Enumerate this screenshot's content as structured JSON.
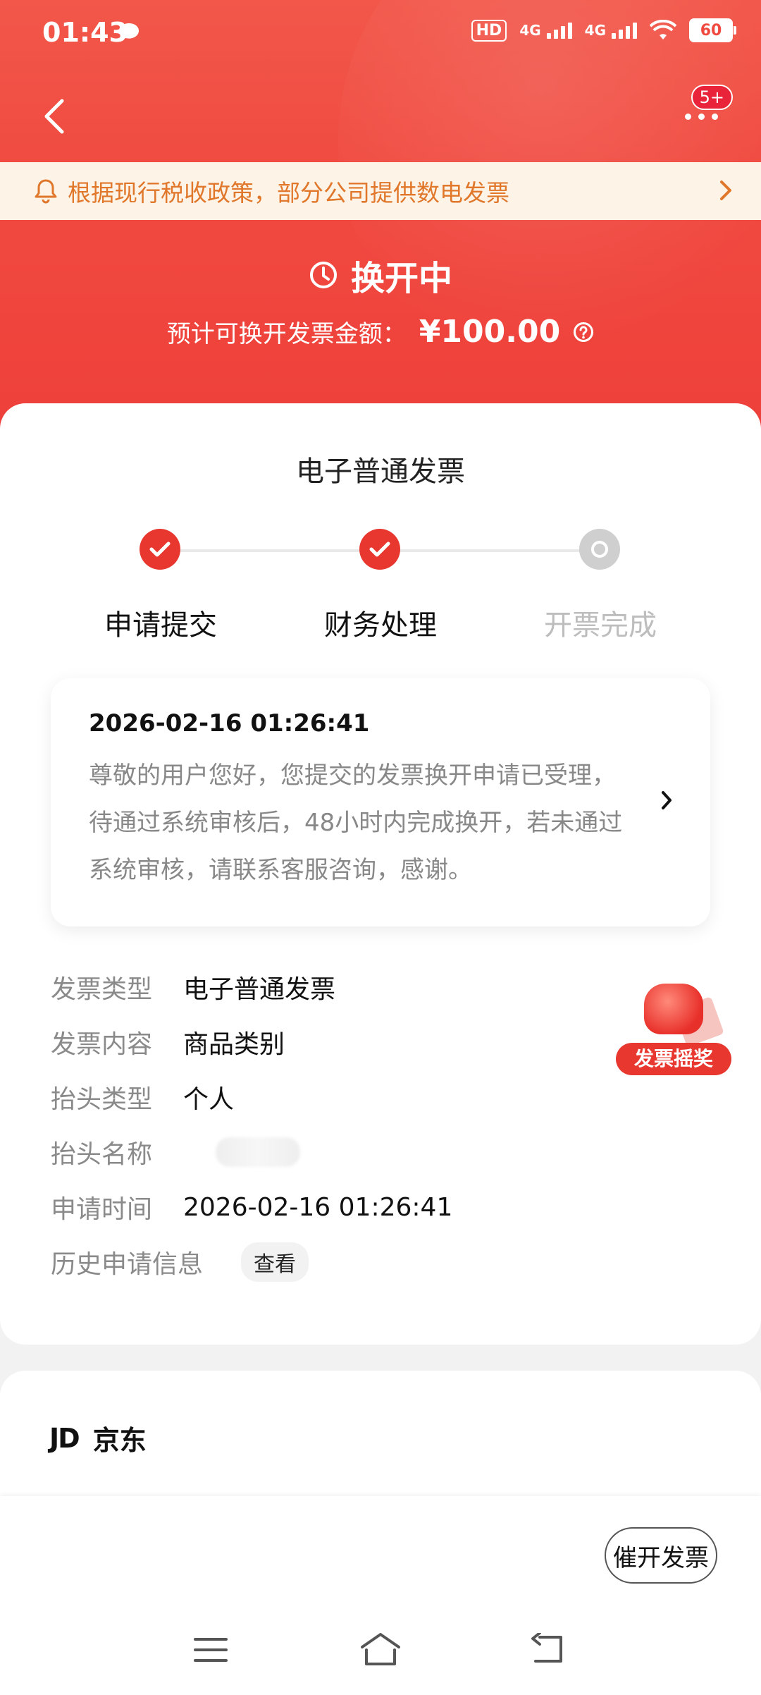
{
  "status_bar": {
    "time": "01:43",
    "hd_label": "HD",
    "net1": "4G",
    "net2": "4G",
    "battery": "60"
  },
  "nav": {
    "more_badge": "5+"
  },
  "notice": {
    "text": "根据现行税收政策，部分公司提供数电发票"
  },
  "hero": {
    "status": "换开中",
    "amount_label": "预计可换开发票金额：",
    "amount": "¥100.00"
  },
  "invoice": {
    "title": "电子普通发票",
    "steps": [
      {
        "label": "申请提交",
        "state": "done"
      },
      {
        "label": "财务处理",
        "state": "done"
      },
      {
        "label": "开票完成",
        "state": "pending"
      }
    ],
    "message": {
      "time": "2026-02-16 01:26:41",
      "text": "尊敬的用户您好，您提交的发票换开申请已受理，待通过系统审核后，48小时内完成换开，若未通过系统审核，请联系客服咨询，感谢。"
    },
    "details": [
      {
        "key": "发票类型",
        "value": "电子普通发票"
      },
      {
        "key": "发票内容",
        "value": "商品类别"
      },
      {
        "key": "抬头类型",
        "value": "个人"
      },
      {
        "key": "抬头名称",
        "value": ""
      },
      {
        "key": "申请时间",
        "value": "2026-02-16 01:26:41"
      },
      {
        "key": "历史申请信息",
        "value": "查看"
      }
    ],
    "promo_label": "发票摇奖"
  },
  "store": {
    "logo": "JD",
    "name": "京东"
  },
  "actions": {
    "urge_button": "催开发票"
  },
  "colors": {
    "accent": "#e8372f",
    "notice_text": "#e0772a"
  }
}
